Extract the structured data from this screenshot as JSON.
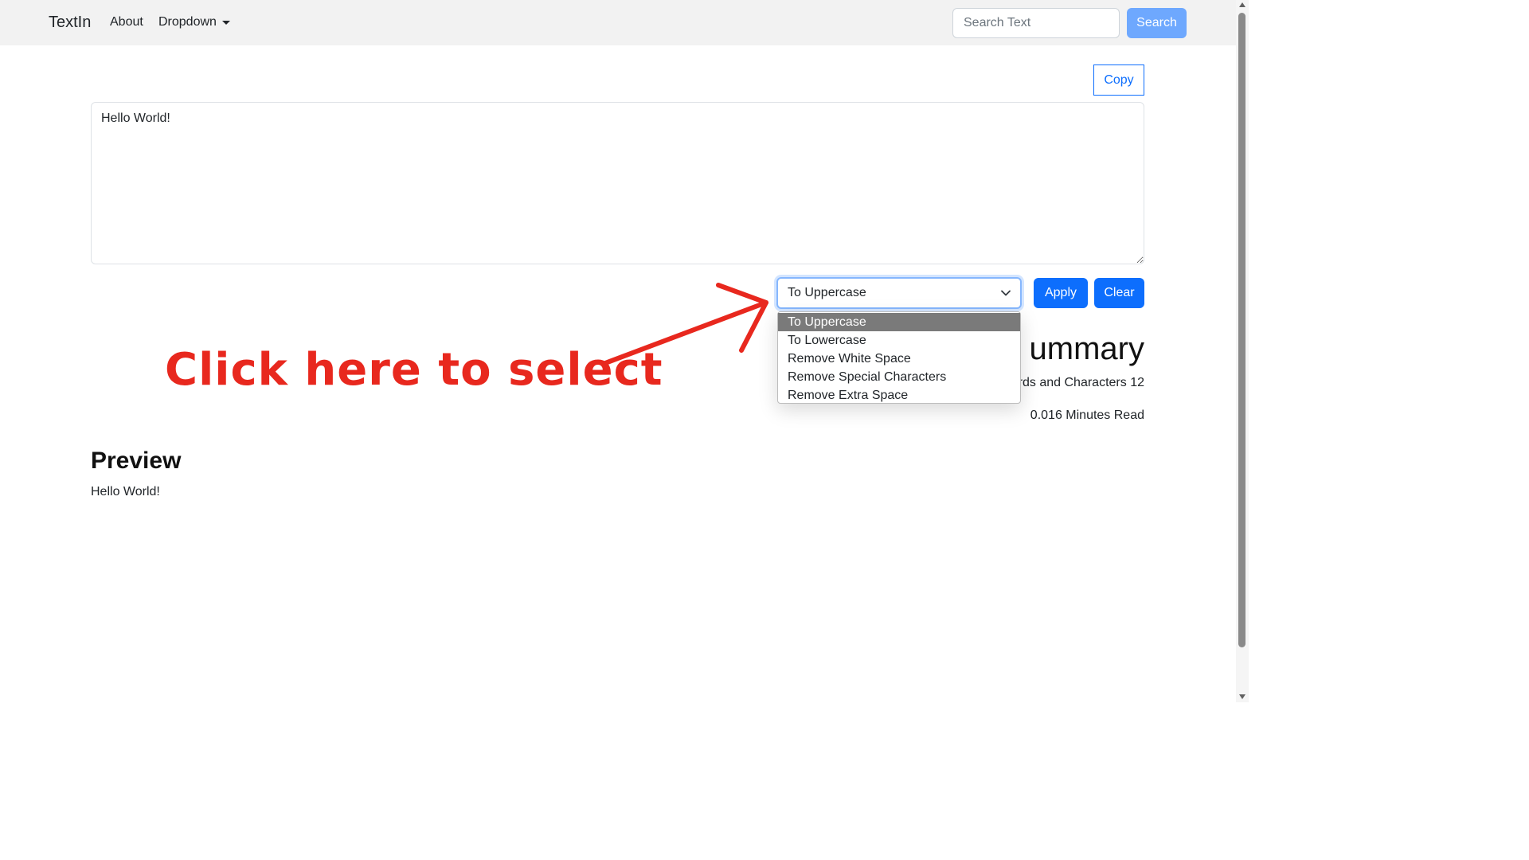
{
  "navbar": {
    "brand": "TextIn",
    "links": {
      "about": "About",
      "dropdown": "Dropdown"
    },
    "search": {
      "placeholder": "Search Text",
      "button_label": "Search"
    }
  },
  "editor": {
    "copy_label": "Copy",
    "text_value": "Hello World!",
    "select": {
      "selected": "To Uppercase",
      "options": [
        "To Uppercase",
        "To Lowercase",
        "Remove White Space",
        "Remove Special Characters",
        "Remove Extra Space"
      ]
    },
    "apply_label": "Apply",
    "clear_label": "Clear"
  },
  "summary": {
    "title_visible": "ummary",
    "word_char_visible": "rds and Characters 12",
    "read_time": "0.016 Minutes Read"
  },
  "preview": {
    "title": "Preview",
    "text": "Hello World!"
  },
  "annotation": {
    "text": "Click here to select",
    "color": "#e8281e"
  },
  "colors": {
    "primary": "#0d6efd",
    "search_button": "#6ea8fe",
    "navbar_bg": "#f2f2f2",
    "option_highlight": "#7a7a7a"
  }
}
